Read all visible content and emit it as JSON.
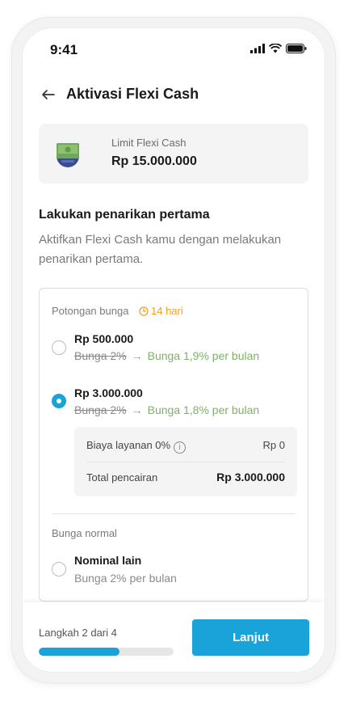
{
  "status_bar": {
    "time": "9:41"
  },
  "header": {
    "title": "Aktivasi Flexi Cash"
  },
  "limit": {
    "label": "Limit Flexi Cash",
    "value": "Rp 15.000.000"
  },
  "section": {
    "title": "Lakukan penarikan pertama",
    "description": "Aktifkan Flexi Cash kamu dengan melakukan penarikan pertama."
  },
  "options": {
    "promo_label": "Potongan bunga",
    "promo_badge": "14 hari",
    "items": [
      {
        "amount": "Rp 500.000",
        "old_rate": "Bunga 2%",
        "new_rate": "Bunga 1,9% per bulan",
        "selected": false
      },
      {
        "amount": "Rp 3.000.000",
        "old_rate": "Bunga 2%",
        "new_rate": "Bunga 1,8% per bulan",
        "selected": true
      }
    ],
    "detail": {
      "fee_label": "Biaya layanan 0%",
      "fee_value": "Rp 0",
      "total_label": "Total pencairan",
      "total_value": "Rp 3.000.000"
    },
    "normal_label": "Bunga normal",
    "normal_item": {
      "amount": "Nominal lain",
      "rate": "Bunga 2% per bulan",
      "selected": false
    }
  },
  "footer": {
    "step_text": "Langkah 2 dari 4",
    "progress": 0.6,
    "next_label": "Lanjut"
  },
  "colors": {
    "accent": "#1aa3d9",
    "promo": "#f0a020",
    "discount": "#7fb069"
  }
}
